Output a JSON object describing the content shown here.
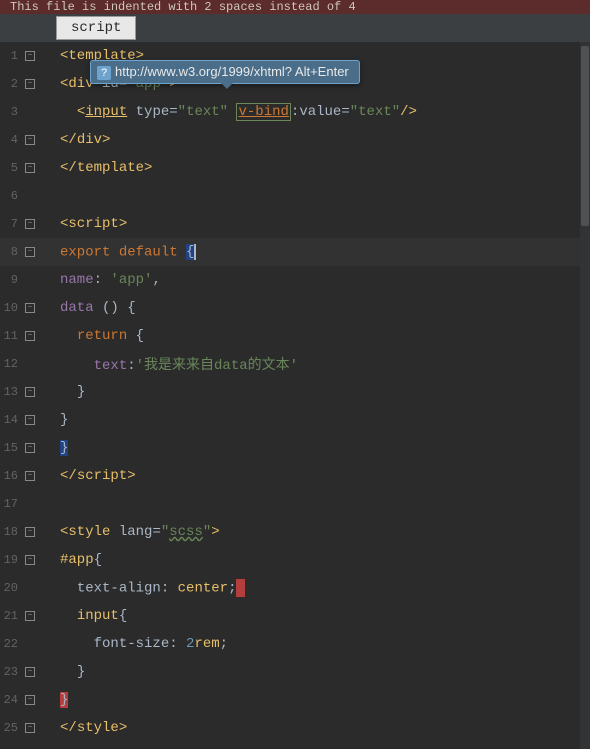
{
  "warning": {
    "text": "This file is indented with 2 spaces instead of 4"
  },
  "tab": {
    "label": "script"
  },
  "tooltip": {
    "text": "http://www.w3.org/1999/xhtml? Alt+Enter"
  },
  "code": {
    "l1": {
      "o": "<",
      "t": "template",
      "c": ">"
    },
    "l2": {
      "o": "<",
      "t": "div",
      "sp": " ",
      "a1": "id",
      "eq": "=",
      "q": "\"",
      "v1": "app",
      "c": ">"
    },
    "l3": {
      "o": "<",
      "t": "input",
      "sp": " ",
      "a1": "type",
      "eq": "=",
      "q": "\"",
      "v1": "text",
      "a2": "v-bind",
      "col": ":",
      "a3": "value",
      "v2": "text",
      "c": "/>"
    },
    "l4": {
      "o": "</",
      "t": "div",
      "c": ">"
    },
    "l5": {
      "o": "</",
      "t": "template",
      "c": ">"
    },
    "l7": {
      "o": "<",
      "t": "script",
      "c": ">"
    },
    "l8": {
      "kw1": "export",
      "kw2": "default",
      "br": "{"
    },
    "l9": {
      "p": "name",
      "col": ":",
      "sp": " ",
      "q": "'",
      "v": "app",
      "comma": ","
    },
    "l10": {
      "p": "data",
      "sp": " ",
      "paren": "()",
      "sp2": " ",
      "br": "{"
    },
    "l11": {
      "kw": "return",
      "sp": " ",
      "br": "{"
    },
    "l12": {
      "p": "text",
      "col": ":",
      "q": "'",
      "v": "我是来来自data的文本"
    },
    "l13": {
      "br": "}"
    },
    "l14": {
      "br": "}"
    },
    "l15": {
      "br": "}"
    },
    "l16": {
      "o": "</",
      "t": "script",
      "c": ">"
    },
    "l18": {
      "o": "<",
      "t": "style",
      "sp": " ",
      "a": "lang",
      "eq": "=",
      "q": "\"",
      "v": "scss",
      "c": ">"
    },
    "l19": {
      "sel": "#app",
      "br": "{"
    },
    "l20": {
      "p": "text-align",
      "col": ":",
      "sp": " ",
      "v": "center",
      "semi": ";"
    },
    "l21": {
      "sel": "input",
      "br": "{"
    },
    "l22": {
      "p": "font-size",
      "col": ":",
      "sp": " ",
      "n": "2",
      "u": "rem",
      "semi": ";"
    },
    "l23": {
      "br": "}"
    },
    "l24": {
      "br": "}"
    },
    "l25": {
      "o": "</",
      "t": "style",
      "c": ">"
    }
  },
  "lines": [
    "1",
    "2",
    "3",
    "4",
    "5",
    "6",
    "7",
    "8",
    "9",
    "10",
    "11",
    "12",
    "13",
    "14",
    "15",
    "16",
    "17",
    "18",
    "19",
    "20",
    "21",
    "22",
    "23",
    "24",
    "25"
  ]
}
